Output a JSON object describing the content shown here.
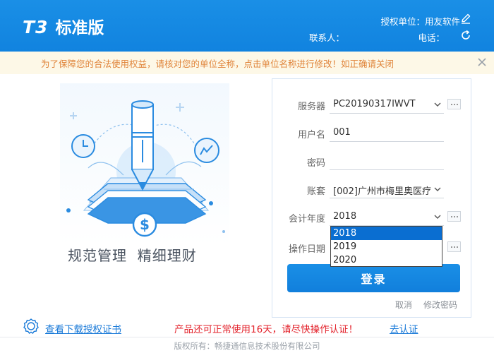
{
  "header": {
    "logo_mark": "T3",
    "edition": "标准版",
    "licensed_unit_label": "授权单位：",
    "licensed_unit_value": "用友软件",
    "contact_label": "联系人：",
    "phone_label": "电话："
  },
  "notice": {
    "text": "为了保障您的合法使用权益，请核对您的单位全称，点击单位名称进行修改！如正确请关闭"
  },
  "slogan": "规范管理  精细理财",
  "login": {
    "server_label": "服务器",
    "server_value": "PC20190317IWVT",
    "username_label": "用户名",
    "username_value": "001",
    "password_label": "密码",
    "password_value": "",
    "account_label": "账套",
    "account_value": "[002]广州市梅里奥医疗",
    "fiscal_year_label": "会计年度",
    "fiscal_year_value": "2018",
    "op_date_label": "操作日期",
    "year_options": [
      "2018",
      "2019",
      "2020"
    ],
    "login_button": "登录",
    "cancel_link": "取消",
    "change_password_link": "修改密码"
  },
  "footer": {
    "cert_link": "查看下载授权证书",
    "warning": "产品还可正常使用16天，请尽快操作认证！",
    "certify_link": "去认证",
    "copyright": "版权所有：畅捷通信息技术股份有限公司"
  },
  "colors": {
    "brand_blue": "#1a8fe6",
    "notice_bg": "#fdf8e7",
    "notice_text": "#e0843a",
    "warning_red": "#e3232c",
    "link_blue": "#1a7ad8"
  }
}
